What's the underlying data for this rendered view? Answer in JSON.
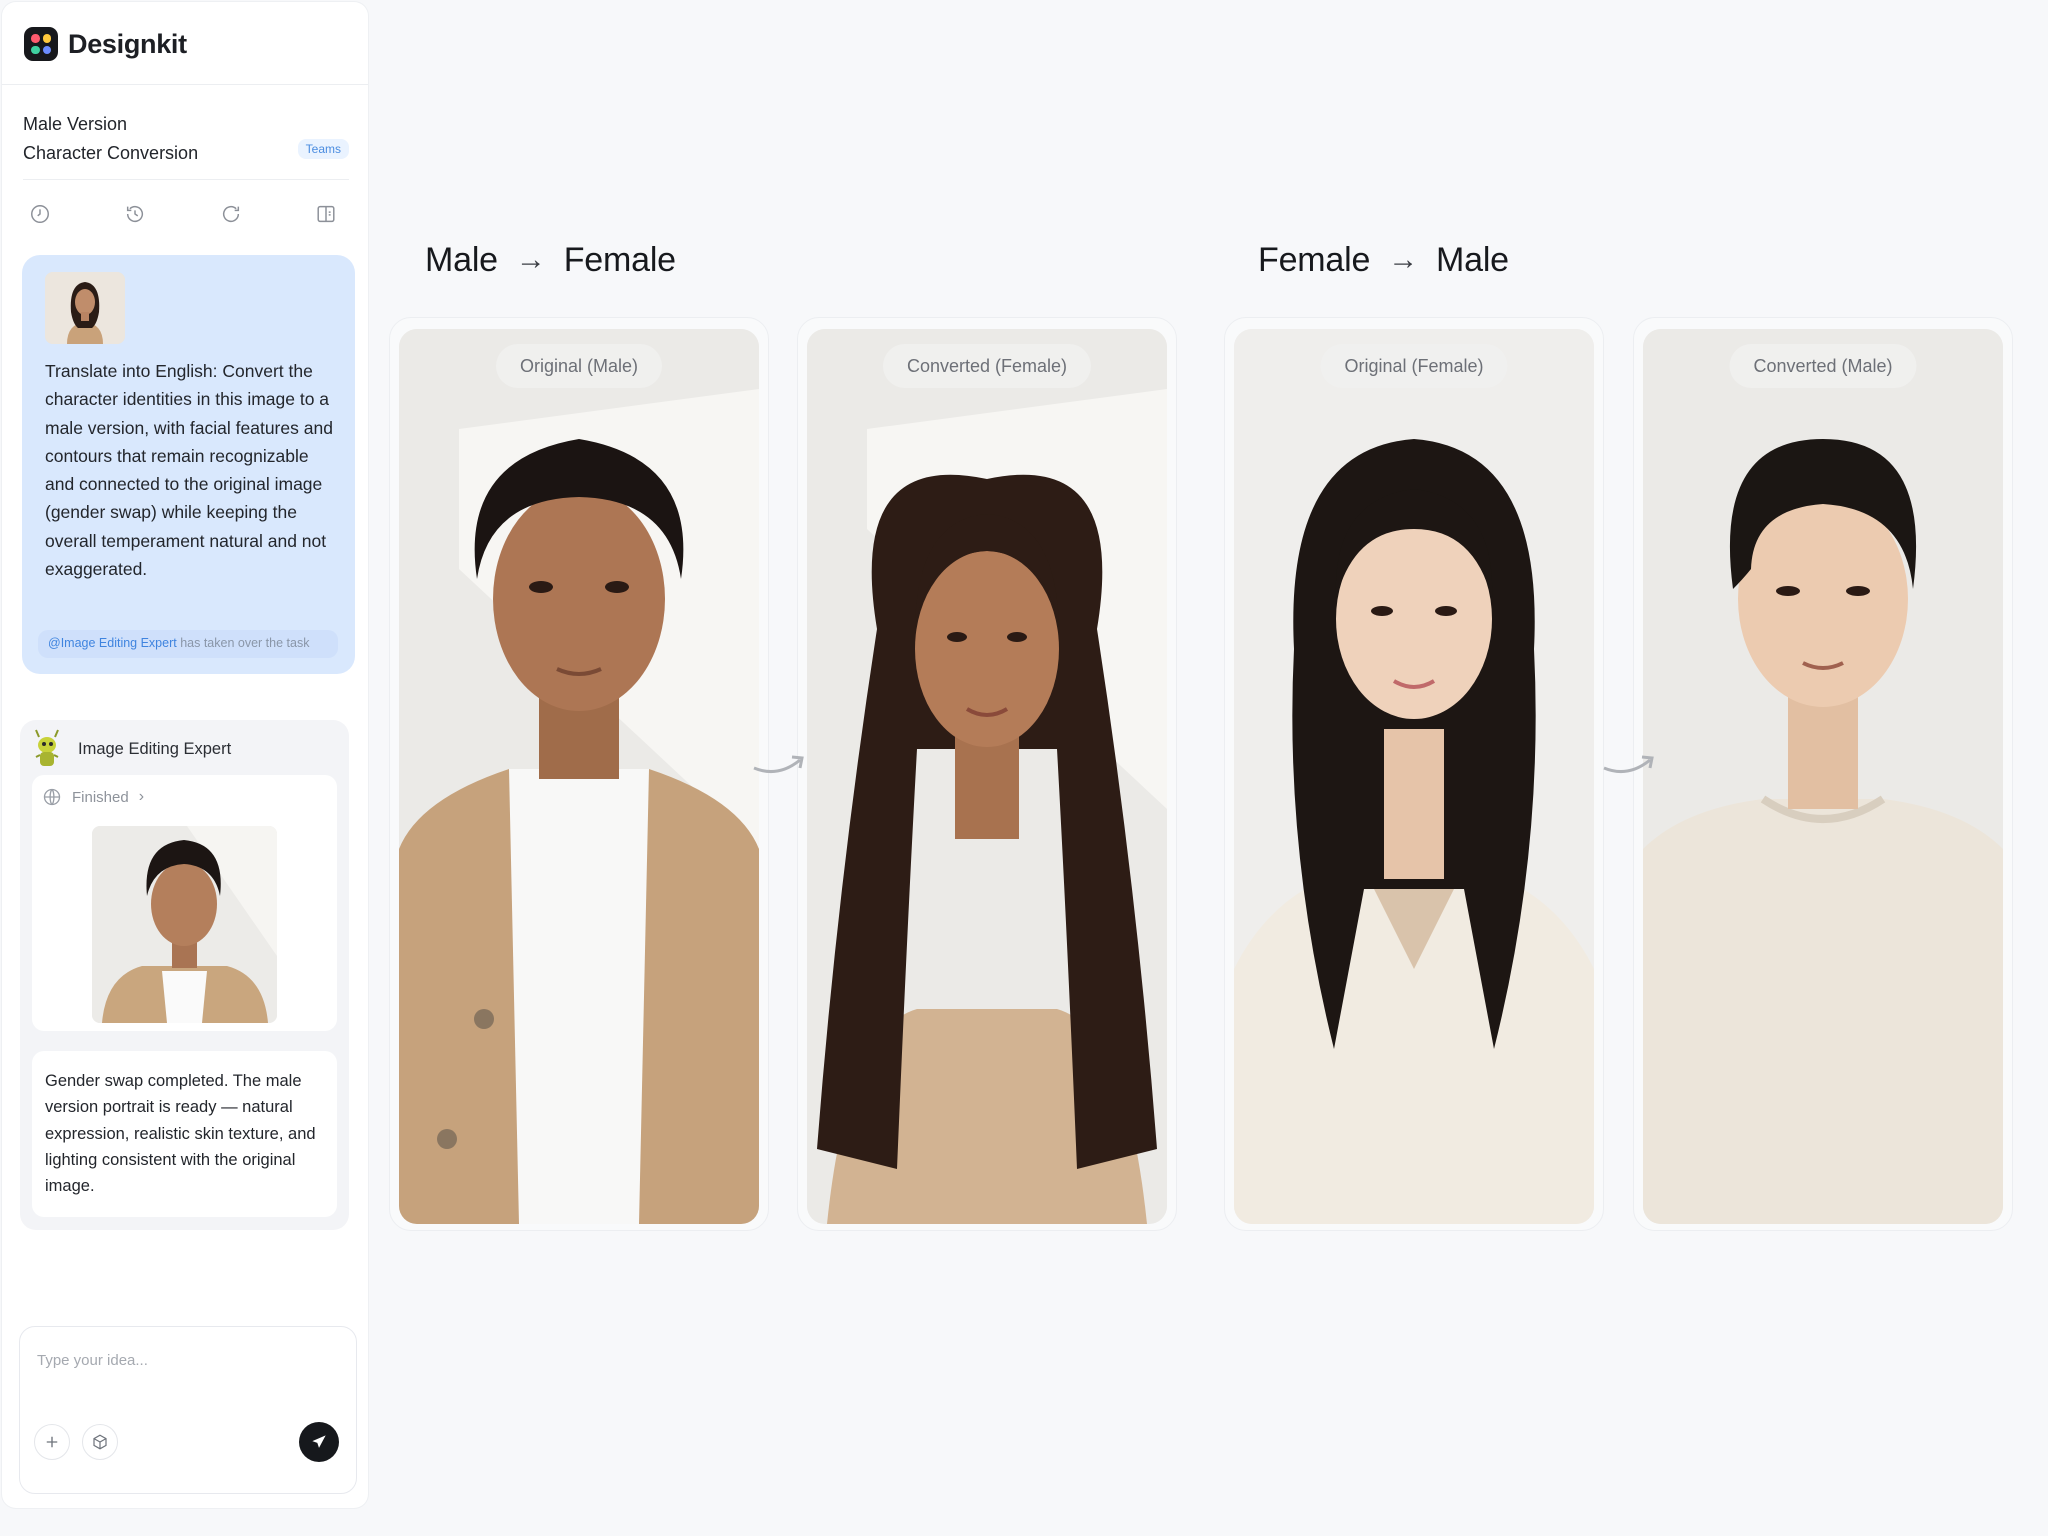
{
  "app": {
    "name": "Designkit",
    "logo_colors": [
      "#ff5a6e",
      "#ffc93c",
      "#3fd0a0",
      "#6c8cff"
    ]
  },
  "project": {
    "title_line1": "Male Version",
    "title_line2": "Character Conversion",
    "badge": "Teams"
  },
  "toolbar": {
    "icons": [
      "clock-icon",
      "history-icon",
      "refresh-icon",
      "panel-icon"
    ]
  },
  "user_message": {
    "text": "Translate into English: Convert the character identities in this image to a male version, with facial features and contours that remain recognizable and connected to the original image (gender swap) while keeping the overall temperament natural and not exaggerated.",
    "handoff_mention": "@Image Editing Expert",
    "handoff_text": " has taken over the task"
  },
  "agent": {
    "name": "Image Editing Expert",
    "status": "Finished",
    "result_text": "Gender swap completed. The male version portrait is ready — natural expression, realistic skin texture, and lighting consistent with the original image."
  },
  "composer": {
    "placeholder": "Type your idea..."
  },
  "canvas": {
    "groups": [
      {
        "from": "Male",
        "arrow": "→",
        "to": "Female",
        "panels": [
          {
            "label": "Original (Male)"
          },
          {
            "label": "Converted (Female)"
          }
        ]
      },
      {
        "from": "Female",
        "arrow": "→",
        "to": "Male",
        "panels": [
          {
            "label": "Original (Female)"
          },
          {
            "label": "Converted (Male)"
          }
        ]
      }
    ]
  },
  "colors": {
    "accent": "#3f84df",
    "user_bubble": "#d9e8fd",
    "send_button": "#16181c"
  }
}
